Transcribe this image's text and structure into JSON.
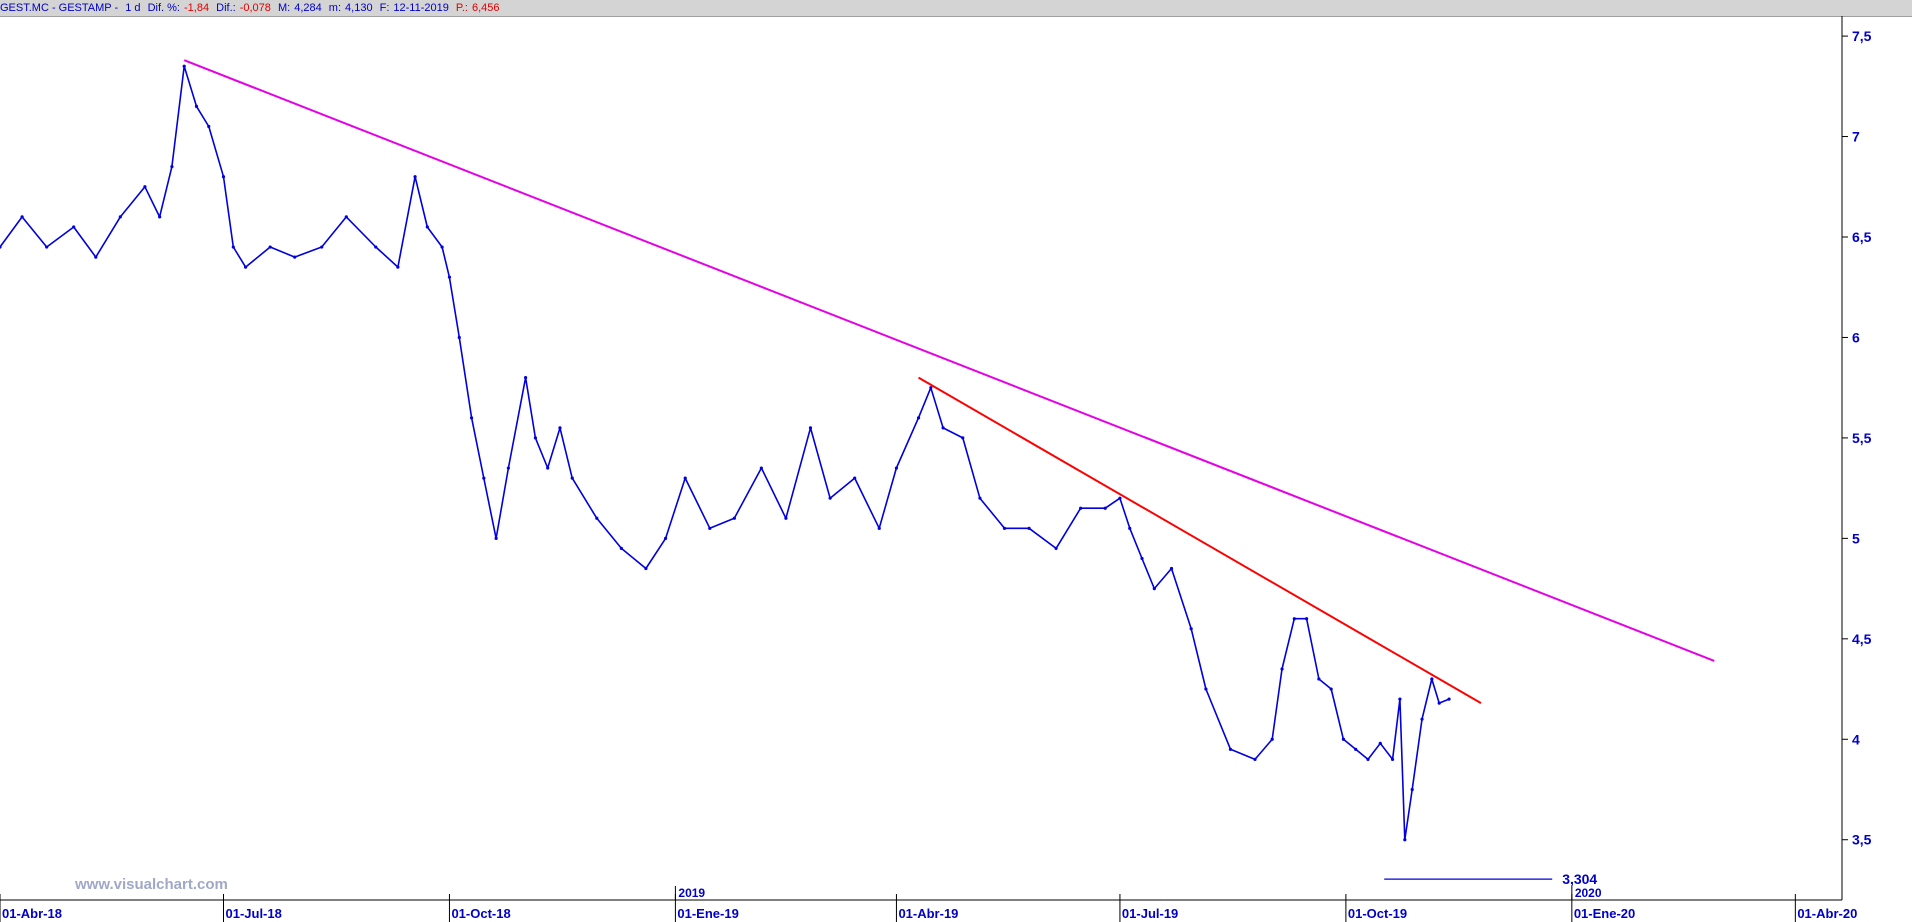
{
  "header": {
    "symbol": "GEST.MC - GESTAMP -",
    "period": "1 d",
    "dif_pct_label": "Dif. %:",
    "dif_pct_value": "-1,84",
    "dif_label": "Dif.:",
    "dif_value": "-0,078",
    "max_label": "M:",
    "max_value": "4,284",
    "min_label": "m:",
    "min_value": "4,130",
    "date_label": "F:",
    "date_value": "12-11-2019",
    "price_label": "P.:",
    "price_value": "6,456"
  },
  "watermark": "www.visualchart.com",
  "colors": {
    "price": "#0000e0",
    "axis": "#0000c8",
    "trend_long": "#e600e6",
    "trend_short": "#ff0000",
    "header_red": "#e00000"
  },
  "chart_data": {
    "type": "line",
    "title": "",
    "xlabel": "",
    "ylabel": "",
    "ylim": [
      3.2,
      7.6
    ],
    "y_ticks": [
      "7,5",
      "7",
      "6,5",
      "6",
      "5,5",
      "5",
      "4,5",
      "4",
      "3,5"
    ],
    "y_tick_values": [
      7.5,
      7.0,
      6.5,
      6.0,
      5.5,
      5.0,
      4.5,
      4.0,
      3.5
    ],
    "x_ticks": [
      "01-Abr-18",
      "01-Jul-18",
      "01-Oct-18",
      "01-Ene-19",
      "01-Abr-19",
      "01-Jul-19",
      "01-Oct-19",
      "01-Ene-20",
      "01-Abr-20"
    ],
    "x_tick_dates": [
      "2018-04-01",
      "2018-07-01",
      "2018-10-01",
      "2019-01-01",
      "2019-04-01",
      "2019-07-01",
      "2019-10-01",
      "2020-01-01",
      "2020-04-01"
    ],
    "year_labels": [
      "2019",
      "2020"
    ],
    "year_label_dates": [
      "2019-01-01",
      "2020-01-01"
    ],
    "xlim": [
      "2018-04-01",
      "2020-04-20"
    ],
    "series": [
      {
        "x": [
          "2018-04-01",
          "2018-04-10",
          "2018-04-20",
          "2018-05-01",
          "2018-05-10",
          "2018-05-20",
          "2018-05-30",
          "2018-06-05",
          "2018-06-10",
          "2018-06-15",
          "2018-06-20",
          "2018-06-25",
          "2018-07-01",
          "2018-07-05",
          "2018-07-10",
          "2018-07-20",
          "2018-07-30",
          "2018-08-10",
          "2018-08-20",
          "2018-09-01",
          "2018-09-10",
          "2018-09-17",
          "2018-09-22",
          "2018-09-28",
          "2018-10-01",
          "2018-10-05",
          "2018-10-10",
          "2018-10-15",
          "2018-10-20",
          "2018-10-25",
          "2018-11-01",
          "2018-11-05",
          "2018-11-10",
          "2018-11-15",
          "2018-11-20",
          "2018-11-30",
          "2018-12-10",
          "2018-12-20",
          "2018-12-28",
          "2019-01-05",
          "2019-01-15",
          "2019-01-25",
          "2019-02-05",
          "2019-02-15",
          "2019-02-25",
          "2019-03-05",
          "2019-03-15",
          "2019-03-25",
          "2019-04-01",
          "2019-04-10",
          "2019-04-15",
          "2019-04-20",
          "2019-04-28",
          "2019-05-05",
          "2019-05-15",
          "2019-05-25",
          "2019-06-05",
          "2019-06-15",
          "2019-06-25",
          "2019-07-01",
          "2019-07-05",
          "2019-07-10",
          "2019-07-15",
          "2019-07-22",
          "2019-07-30",
          "2019-08-05",
          "2019-08-15",
          "2019-08-25",
          "2019-09-01",
          "2019-09-05",
          "2019-09-10",
          "2019-09-15",
          "2019-09-20",
          "2019-09-25",
          "2019-09-30",
          "2019-10-05",
          "2019-10-10",
          "2019-10-15",
          "2019-10-20",
          "2019-10-23",
          "2019-10-25",
          "2019-10-28",
          "2019-11-01",
          "2019-11-05",
          "2019-11-08",
          "2019-11-12"
        ],
        "y": [
          6.45,
          6.6,
          6.45,
          6.55,
          6.4,
          6.6,
          6.75,
          6.6,
          6.85,
          7.35,
          7.15,
          7.05,
          6.8,
          6.45,
          6.35,
          6.45,
          6.4,
          6.45,
          6.6,
          6.45,
          6.35,
          6.8,
          6.55,
          6.45,
          6.3,
          6.0,
          5.6,
          5.3,
          5.0,
          5.35,
          5.8,
          5.5,
          5.35,
          5.55,
          5.3,
          5.1,
          4.95,
          4.85,
          5.0,
          5.3,
          5.05,
          5.1,
          5.35,
          5.1,
          5.55,
          5.2,
          5.3,
          5.05,
          5.35,
          5.6,
          5.75,
          5.55,
          5.5,
          5.2,
          5.05,
          5.05,
          4.95,
          5.15,
          5.15,
          5.2,
          5.05,
          4.9,
          4.75,
          4.85,
          4.55,
          4.25,
          3.95,
          3.9,
          4.0,
          4.35,
          4.6,
          4.6,
          4.3,
          4.25,
          4.0,
          3.95,
          3.9,
          3.98,
          3.9,
          4.2,
          3.5,
          3.75,
          4.1,
          4.3,
          4.18,
          4.2
        ]
      }
    ],
    "trendlines": [
      {
        "from": [
          "2018-06-15",
          7.38
        ],
        "to": [
          "2020-02-28",
          4.39
        ]
      },
      {
        "from": [
          "2019-04-10",
          5.8
        ],
        "to": [
          "2019-11-25",
          4.18
        ]
      }
    ],
    "annotations": [
      {
        "text": "3,304",
        "x": "2019-10-28",
        "y": 3.304
      }
    ]
  }
}
